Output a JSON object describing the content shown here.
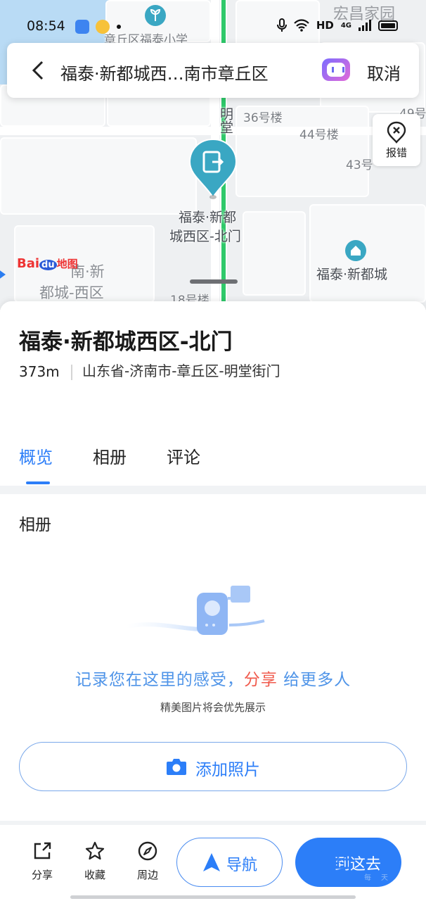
{
  "status_bar": {
    "time": "08:54",
    "network": "HD",
    "signal": "4G"
  },
  "map": {
    "labels": {
      "school": "章丘区福泰小学",
      "road": "明堂",
      "bldg36": "36号楼",
      "bldg44": "44号楼",
      "bldg49": "49号",
      "bldg43": "43号",
      "bldg18": "18号楼",
      "poi_line1": "福泰·新都",
      "poi_line2": "城西区-北门",
      "poi_community": "福泰·新都城",
      "sw_line1": "南·新",
      "sw_line2": "都城-西区"
    },
    "baidu_logo": {
      "part1": "Bai",
      "part2": "du",
      "part3": "地图"
    },
    "report_label": "报错"
  },
  "search_bar": {
    "query": "福泰·新都城西…南市章丘区",
    "cancel_label": "取消"
  },
  "poi": {
    "title": "福泰·新都城西区-北门",
    "distance": "373m",
    "address": "山东省-济南市-章丘区-明堂街门"
  },
  "tabs": [
    {
      "label": "概览",
      "active": true
    },
    {
      "label": "相册",
      "active": false
    },
    {
      "label": "评论",
      "active": false
    }
  ],
  "album": {
    "heading": "相册",
    "prompt_before": "记录您在这里的感受，",
    "prompt_highlight": "分享",
    "prompt_after": "给更多人",
    "sub": "精美图片将会优先展示",
    "add_photo_label": "添加照片"
  },
  "bottom_bar": {
    "share_label": "分享",
    "favorite_label": "收藏",
    "nearby_label": "周边",
    "navigate_label": "导航",
    "go_label": "到这去"
  },
  "watermarks": {
    "top": "宏昌家园",
    "bottom": "章丘",
    "bottom_sub": "每天"
  },
  "colors": {
    "accent": "#2c7ef8",
    "highlight": "#f05a4c",
    "route_green": "#2fc96a",
    "pin_teal": "#3aa7c3"
  }
}
